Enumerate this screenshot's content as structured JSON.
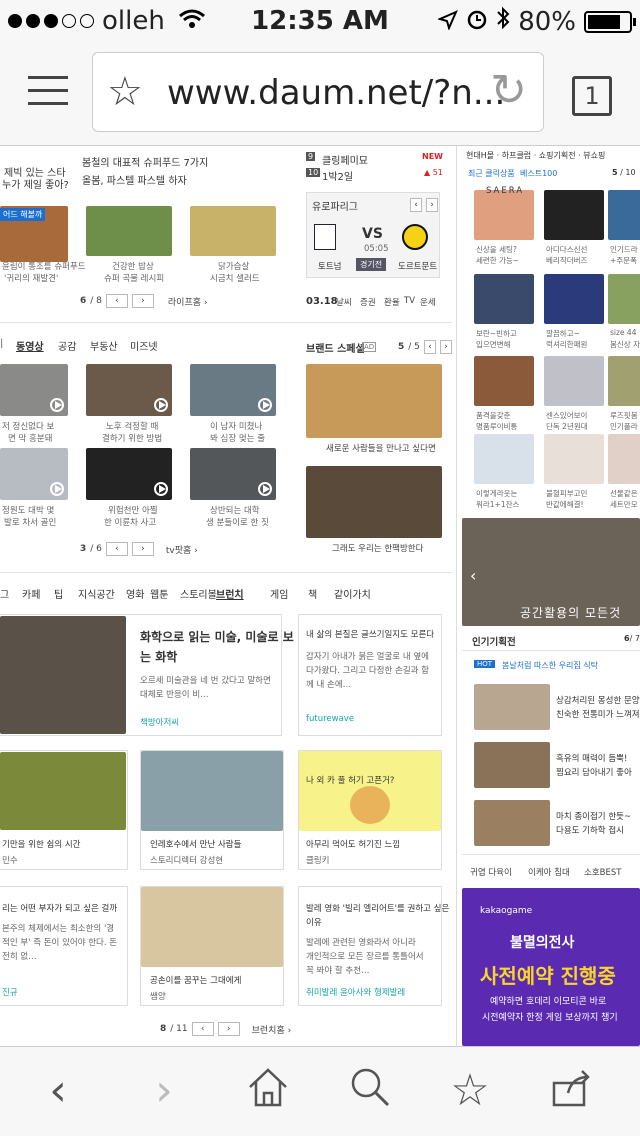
{
  "status": {
    "carrier": "olleh",
    "time": "12:35 AM",
    "battery": "80%"
  },
  "browser": {
    "url": "www.daum.net/?n...",
    "tab_count": "1"
  },
  "top_left": {
    "caption1a": "제빅 있는 스타",
    "caption1b": "누가 제일 좋아?",
    "tag": "어드 해볼까",
    "food_items": [
      [
        "윤림이 통조를 슈퍼푸드",
        "'귀리의 재발견'"
      ],
      [
        "건강한 밥상",
        "슈퍼 곡물 레시피"
      ],
      [
        "닭가슴살",
        "시금치 샐러드"
      ]
    ],
    "page": "6",
    "page_total": "/ 8",
    "more": "라이프홈 ›",
    "headline1": "봄철의 대표적 슈퍼푸드 7가지",
    "headline2": "올봄, 파스텔 파스텔 하자"
  },
  "ranking": {
    "r9": "9",
    "r9_text": "클링페미묘",
    "r9_badge": "NEW",
    "r10": "10",
    "r10_text": "1박2일",
    "r10_badge": "▲ 51"
  },
  "match": {
    "league": "유로파리그",
    "home": "토트넘",
    "vs": "VS",
    "time": "05:05",
    "status": "경기전",
    "away": "도르트문트",
    "date": "03.18",
    "tabs": [
      "날씨",
      "증권",
      "환율",
      "TV",
      "운세"
    ]
  },
  "video": {
    "tabs": [
      "동영상",
      "공감",
      "부동산",
      "미즈넷"
    ],
    "items": [
      [
        "저 정신없다 보",
        "면 막 흥분돼"
      ],
      [
        "노후 걱정할 때",
        "결하기 위한 방법"
      ],
      [
        "이 남자 미쳤나",
        "봐 심장 멎는 줄"
      ],
      [
        "정원도 대박 몇",
        "발로 차서 골인"
      ],
      [
        "위험천만 아찔",
        "한 이륜차 사고"
      ],
      [
        "상반되는 대학",
        "생 분들이로 한 짓"
      ]
    ],
    "page": "3",
    "page_total": "/ 6",
    "more": "tv팟홈 ›"
  },
  "brand": {
    "title": "브랜드 스페셜",
    "ad": "AD",
    "page": "5",
    "page_total": "/ 5",
    "caption1": "새로운 사람들을 만나고 싶다면",
    "caption2": "그래도 우리는 한팩방한다"
  },
  "shopping": {
    "header": "현대H몰 · 하프클럽 · 쇼핑기획전 · 뷰쇼핑",
    "tab1": "최근 클릭상품",
    "tab2": "베스트100",
    "page": "5",
    "page_total": "/ 10",
    "brand1": "SAERA",
    "items": [
      [
        "신상을 세팅?",
        "세련한 가능~"
      ],
      [
        "아디다스신선",
        "베리직더버즈"
      ],
      [
        "인기드라",
        "+주문폭"
      ],
      [
        "보란~빈하고",
        "입으면변해"
      ],
      [
        "깔끔하고~",
        "럭셔리한패원"
      ],
      [
        "size 44",
        "봄신상 자"
      ],
      [
        "품격을갖춘",
        "명품루이비통"
      ],
      [
        "센스있어보이",
        "단독 2년원대"
      ],
      [
        "루즈핏봄",
        "인기폴라"
      ],
      [
        "이렇게라웃는",
        "워라1+1잔스"
      ],
      [
        "불혈피부고민",
        "반값에해결!"
      ],
      [
        "선물같은",
        "세트만모"
      ]
    ],
    "banner_text": "공간활용의 모든것",
    "planning_title": "인기기획전",
    "planning_page": "6",
    "planning_total": "/ 7",
    "hot_badge": "HOT",
    "hot_text": "봄날처럼 따스한 우리집 식탁",
    "plans": [
      [
        "상감처리된 몽성한 문양",
        "친숙한 전통미가 느껴져"
      ],
      [
        "흑유의 매력이 듬뿍!",
        "찜요리 담아내기 좋아"
      ],
      [
        "마치 종이접기 한듯~",
        "다용도 기하학 접시"
      ]
    ],
    "plan_tabs": [
      "귀엽 다육이",
      "이케아 침대",
      "소호BEST"
    ],
    "ad_brand": "kakaogame",
    "ad_title": "불멸의전사",
    "ad_main": "사전예약 진행중",
    "ad_sub1": "예약하면 호데리 이모티콘 바로",
    "ad_sub2": "시전예약자 한정 게임 보상까지 챙기"
  },
  "categories": {
    "tabs": [
      "그",
      "카페",
      "팁",
      "지식공간",
      "영화",
      "웹툰",
      "스토리볼",
      "브런치",
      "게임",
      "책",
      "같이가치"
    ],
    "active": "브런치"
  },
  "brunch": {
    "feature_title1": "화학으로 읽는 미술, 미술로 보",
    "feature_title2": "는 화학",
    "feature_desc1": "오르세 미술관을 네 번 갔다고 말하면",
    "feature_desc2": "대체로 반응이 비…",
    "feature_author": "책방아저씨",
    "side_title": "내 삶의 본질은 글쓰기일지도 모른다",
    "side_desc1": "갑자기 아내가 붉은 얼굴로 내 옆에",
    "side_desc2": "다가왔다. 그리고 다정한 손길과 함",
    "side_desc3": "께 내 손에…",
    "side_author": "futurewave",
    "row2": [
      [
        "기만을 위한 쉼의 시간",
        "민수"
      ],
      [
        "인레호수에서 만난 사람들",
        "스토리디렉터 강성현"
      ],
      [
        "아무리 먹어도 허기진 느낌",
        "클링키"
      ]
    ],
    "cat_text": "나 외 카 풀 허기 고픈거?",
    "row3_left": [
      "리는 어떤 부자가 되고 싶은 걸까",
      "본주의 체제에서는 최소한의 '경",
      "적인 부' 즉 돈이 있어야 한다. 돈",
      "전히 없…",
      "진규"
    ],
    "row3_mid": [
      "공손이를 꿈꾸는 그대에게",
      "쌤양"
    ],
    "row3_right": [
      "발레 영화 '빌리 엘리어트'를 권하고 싶은",
      "이유",
      "발레에 관련된 영화라서 아니라",
      "개인적으로 모든 장르를 통틀어서",
      "꼭 봐야 할 추천…",
      "취미발레 윤아사와 형제발레"
    ],
    "page": "8",
    "page_total": "/ 11",
    "more": "브런치홈 ›"
  },
  "colors": {
    "accent": "#1a6fd1",
    "red": "#e02020",
    "teal": "#1aa4a4",
    "purple": "#5a2bb0",
    "kakao_yellow": "#f9d52a"
  }
}
